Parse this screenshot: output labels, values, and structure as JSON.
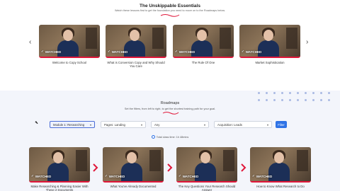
{
  "essentials": {
    "title": "The Unskippable Essentials",
    "subtitle": "Watch these lessons first to get the foundation you need to move on to the Roadmaps below.",
    "prev_icon": "chevron-left-icon",
    "next_icon": "chevron-right-icon",
    "videos": [
      {
        "label": "Welcome to Copy School",
        "badge": "WATCHED"
      },
      {
        "label": "What is Conversion Copy and Why Should You Care",
        "badge": "WATCHED"
      },
      {
        "label": "The Rule Of One",
        "badge": "WATCHED"
      },
      {
        "label": "Market Sophistication",
        "badge": "WATCHED"
      }
    ]
  },
  "roadmaps": {
    "title": "Roadmaps",
    "subtitle": "Set the filters, from left to right, to get the shortest training path for your goal.",
    "filters": [
      {
        "value": "Module 1: Researching"
      },
      {
        "value": "Pages: Landing"
      },
      {
        "value": "Any"
      },
      {
        "value": "Acquisition: Leads"
      }
    ],
    "filter_button": "Filter",
    "total_time": "Total class time: 1h 48mins",
    "videos": [
      {
        "label": "Make Researching & Planning Easier With These 2 Documents",
        "badge": "WATCHED"
      },
      {
        "label": "What You've Already Documented",
        "badge": "WATCHED"
      },
      {
        "label": "The Key Questions Your Research Should Answer",
        "badge": "WATCHED"
      },
      {
        "label": "How to Know What Research to Do",
        "badge": "WATCHED"
      }
    ]
  },
  "colors": {
    "accent_red": "#e0173a",
    "filter_blue": "#2f73e6",
    "section_bg": "#f3f5fb"
  }
}
